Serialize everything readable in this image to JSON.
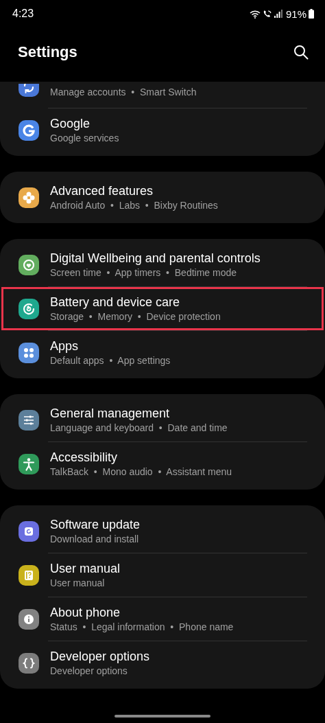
{
  "status_bar": {
    "time": "4:23",
    "battery_percent": "91%"
  },
  "header": {
    "title": "Settings"
  },
  "groups": [
    {
      "items": [
        {
          "subtitle": "Manage accounts  •  Smart Switch",
          "color": "#4a78d8",
          "highlighted": false
        },
        {
          "title": "Google",
          "subtitle": "Google services",
          "color": "#4a85e6",
          "highlighted": false
        }
      ]
    },
    {
      "items": [
        {
          "title": "Advanced features",
          "subtitle": "Android Auto  •  Labs  •  Bixby Routines",
          "color": "#e8a94a",
          "highlighted": false
        }
      ]
    },
    {
      "items": [
        {
          "title": "Digital Wellbeing and parental controls",
          "subtitle": "Screen time  •  App timers  •  Bedtime mode",
          "color": "#62ad5e",
          "highlighted": false
        },
        {
          "title": "Battery and device care",
          "subtitle": "Storage  •  Memory  •  Device protection",
          "color": "#1fa88e",
          "highlighted": true
        },
        {
          "title": "Apps",
          "subtitle": "Default apps  •  App settings",
          "color": "#5b8fdc",
          "highlighted": false
        }
      ]
    },
    {
      "items": [
        {
          "title": "General management",
          "subtitle": "Language and keyboard  •  Date and time",
          "color": "#5c7f9a",
          "highlighted": false
        },
        {
          "title": "Accessibility",
          "subtitle": "TalkBack  •  Mono audio  •  Assistant menu",
          "color": "#2f9a5a",
          "highlighted": false
        }
      ]
    },
    {
      "items": [
        {
          "title": "Software update",
          "subtitle": "Download and install",
          "color": "#6a6ee0",
          "highlighted": false
        },
        {
          "title": "User manual",
          "subtitle": "User manual",
          "color": "#c9b21c",
          "highlighted": false
        },
        {
          "title": "About phone",
          "subtitle": "Status  •  Legal information  •  Phone name",
          "color": "#828282",
          "highlighted": false
        },
        {
          "title": "Developer options",
          "subtitle": "Developer options",
          "color": "#7c7c7c",
          "highlighted": false
        }
      ]
    }
  ]
}
